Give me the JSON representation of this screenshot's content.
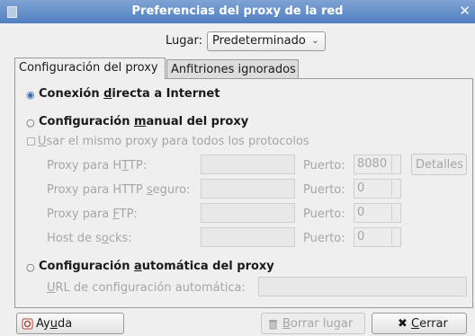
{
  "window": {
    "title": "Preferencias del proxy de la red"
  },
  "location": {
    "label": "Lugar:",
    "value": "Predeterminado"
  },
  "tabs": [
    "Configuración del proxy",
    "Anfitriones ignorados"
  ],
  "direct": {
    "pre": "Conexión ",
    "key": "d",
    "post": "irecta a Internet",
    "selected": true
  },
  "manual": {
    "pre": "Configuración ",
    "key": "m",
    "post": "anual del proxy",
    "selected": false,
    "same_proxy": {
      "key": "U",
      "post": "sar el mismo proxy para todos los protocolos",
      "checked": false
    },
    "port_label": "Puerto:",
    "rows": [
      {
        "pre": "Proxy para H",
        "key": "T",
        "post": "TP:",
        "port": "8080"
      },
      {
        "pre": "Proxy para HTTP ",
        "key": "s",
        "post": "eguro:",
        "port": "0"
      },
      {
        "pre": "Proxy para ",
        "key": "F",
        "post": "TP:",
        "port": "0"
      },
      {
        "pre": "Host de s",
        "key": "o",
        "post": "cks:",
        "port": "0"
      }
    ],
    "details_button": "Detalles"
  },
  "automatic": {
    "pre": "Configuración ",
    "key": "a",
    "post": "utomática del proxy",
    "selected": false,
    "url": {
      "key": "U",
      "post": "RL de configuración automática:"
    }
  },
  "buttons": {
    "help": {
      "pre": "Ay",
      "key": "u",
      "post": "da"
    },
    "delete": {
      "pre": "",
      "key": "B",
      "post": "orrar lugar"
    },
    "close": {
      "pre": "",
      "key": "C",
      "post": "errar"
    }
  },
  "colors": {
    "titlebar": "#5a88c6",
    "selected_radio": "#3b6db0",
    "disabled_text": "#a6a6a6"
  }
}
